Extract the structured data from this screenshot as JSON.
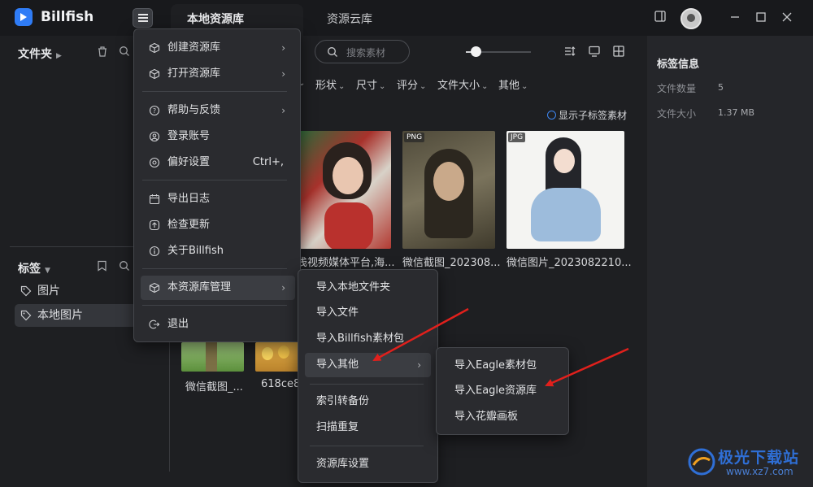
{
  "app": {
    "name": "Billfish"
  },
  "tabs": [
    {
      "label": "本地资源库"
    },
    {
      "label": "资源云库"
    }
  ],
  "sidebar": {
    "folders_title": "文件夹",
    "tags_title": "标签",
    "tags": [
      {
        "label": "图片"
      },
      {
        "label": "本地图片"
      }
    ]
  },
  "toolbar": {
    "search_placeholder": "搜索素材",
    "filters": [
      "形状",
      "尺寸",
      "评分",
      "文件大小",
      "其他"
    ],
    "show_sub_tags": "显示子标签素材",
    "zoom_fraction": 0.15
  },
  "grid": {
    "items": [
      {
        "name": "浅视频媒体平台,海...",
        "format": ""
      },
      {
        "name": "微信截图_202308...",
        "format": "PNG"
      },
      {
        "name": "微信图片_2023082210...",
        "format": "JPG"
      },
      {
        "name": "微信截图_...",
        "format": ""
      },
      {
        "name": "618ce8",
        "format": ""
      }
    ]
  },
  "right_panel": {
    "title": "标签信息",
    "file_count_label": "文件数量",
    "file_count_value": "5",
    "file_size_label": "文件大小",
    "file_size_value": "1.37 MB"
  },
  "main_menu": {
    "items": [
      {
        "label": "创建资源库",
        "icon": "cube-icon",
        "submenu": true
      },
      {
        "label": "打开资源库",
        "icon": "cube-icon",
        "submenu": true
      },
      {
        "label": "帮助与反馈",
        "icon": "help-icon",
        "submenu": true
      },
      {
        "label": "登录账号",
        "icon": "user-icon",
        "submenu": false
      },
      {
        "label": "偏好设置",
        "icon": "gear-icon",
        "submenu": false,
        "shortcut": "Ctrl+,"
      },
      {
        "label": "导出日志",
        "icon": "calendar-icon",
        "submenu": false
      },
      {
        "label": "检查更新",
        "icon": "update-icon",
        "submenu": false
      },
      {
        "label": "关于Billfish",
        "icon": "info-icon",
        "submenu": false
      },
      {
        "label": "本资源库管理",
        "icon": "cube-icon",
        "submenu": true
      },
      {
        "label": "退出",
        "icon": "exit-icon",
        "submenu": false
      }
    ]
  },
  "library_menu": {
    "items": [
      {
        "label": "导入本地文件夹"
      },
      {
        "label": "导入文件"
      },
      {
        "label": "导入Billfish素材包"
      },
      {
        "label": "导入其他",
        "submenu": true
      },
      {
        "label": "索引转备份"
      },
      {
        "label": "扫描重复"
      },
      {
        "label": "资源库设置"
      }
    ]
  },
  "import_other_menu": {
    "items": [
      {
        "label": "导入Eagle素材包"
      },
      {
        "label": "导入Eagle资源库"
      },
      {
        "label": "导入花瓣画板"
      }
    ]
  },
  "watermark": {
    "text": "极光下载站",
    "url": "www.xz7.com"
  },
  "colors": {
    "accent": "#2f7cf6",
    "arrow": "#e0201c"
  }
}
